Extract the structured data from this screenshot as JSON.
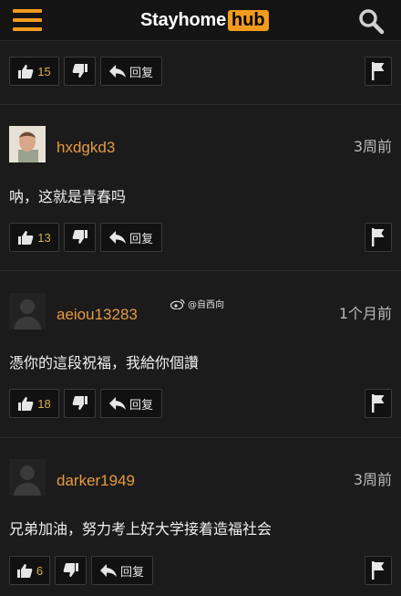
{
  "header": {
    "logo_main": "Stayhome",
    "logo_hub": "hub",
    "accent": "#f29b1d"
  },
  "reply_label": "回复",
  "top_actions": {
    "likes": "15"
  },
  "watermark": "@自西向",
  "comments": [
    {
      "username": "hxdgkd3",
      "time": "3周前",
      "text": "呐，这就是青春吗",
      "likes": "13"
    },
    {
      "username": "aeiou13283",
      "time": "1个月前",
      "text": "憑你的這段祝福，我給你個讚",
      "likes": "18"
    },
    {
      "username": "darker1949",
      "time": "3周前",
      "text": "兄弟加油，努力考上好大学接着造福社会",
      "likes": "6"
    }
  ]
}
